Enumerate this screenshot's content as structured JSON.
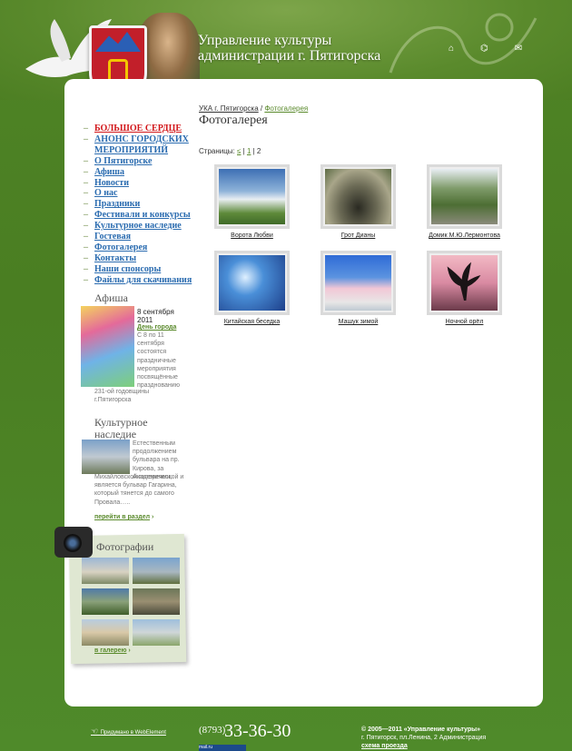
{
  "header": {
    "title_line1": "Управление культуры",
    "title_line2": "администрации г. Пятигорска",
    "icons": [
      {
        "name": "home-icon",
        "glyph": "⌂"
      },
      {
        "name": "sitemap-icon",
        "glyph": "⌬"
      },
      {
        "name": "mail-icon",
        "glyph": "✉"
      }
    ]
  },
  "menu": [
    {
      "label": "БОЛЬШОЕ СЕРДЦЕ",
      "highlight": true
    },
    {
      "label": "АНОНС ГОРОДСКИХ МЕРОПРИЯТИЙ"
    },
    {
      "label": "О Пятигорске"
    },
    {
      "label": "Афиша"
    },
    {
      "label": "Новости"
    },
    {
      "label": "О нас"
    },
    {
      "label": "Праздники"
    },
    {
      "label": "Фестивали и конкурсы"
    },
    {
      "label": "Культурное наследие"
    },
    {
      "label": "Гостевая"
    },
    {
      "label": "Фотогалерея"
    },
    {
      "label": "Контакты"
    },
    {
      "label": "Наши спонсоры"
    },
    {
      "label": "Файлы для скачивания"
    }
  ],
  "afisha": {
    "heading": "Афиша",
    "date": "8 сентября 2011",
    "event": "День города",
    "text1": "С 8 по 11 сентября состоятся праздничные мероприятия посвящённые празднованию",
    "text2": "231-ой годовщины г.Пятигорска"
  },
  "kult": {
    "heading_line1": "Культурное",
    "heading_line2": "наследие",
    "text1": "Естественным продолжением бульвара на пр. Кирова, за Академической и",
    "text2": "Михайловской галереями, является бульвар Гагарина, который тянется до самого Провала…..",
    "more": "перейти в раздел"
  },
  "photos": {
    "heading": "Фотографии",
    "more": "в галерею"
  },
  "breadcrumb": {
    "root": "УКА г. Пятигорска",
    "sep": " / ",
    "current": "Фотогалерея"
  },
  "page_title": "Фотогалерея",
  "pages": {
    "label": "Страницы:",
    "prev": "≤",
    "p1": "1",
    "p2": "2"
  },
  "gallery": [
    {
      "caption": "Ворота Любви"
    },
    {
      "caption": "Грот Дианы"
    },
    {
      "caption": "Домик М.Ю.Лермонтова"
    },
    {
      "caption": "Китайская беседка"
    },
    {
      "caption": "Машук зимой"
    },
    {
      "caption": "Ночной орёл"
    }
  ],
  "footer": {
    "made": "Придумано в WebElement",
    "phone_code": "(8793)",
    "phone": "33-36-30",
    "copy": "© 2005—2011 «Управление культуры»",
    "address": "г. Пятигорск, пл.Ленина, 2 Администрация",
    "map": "схема проезда",
    "counter": "mail.ru"
  }
}
